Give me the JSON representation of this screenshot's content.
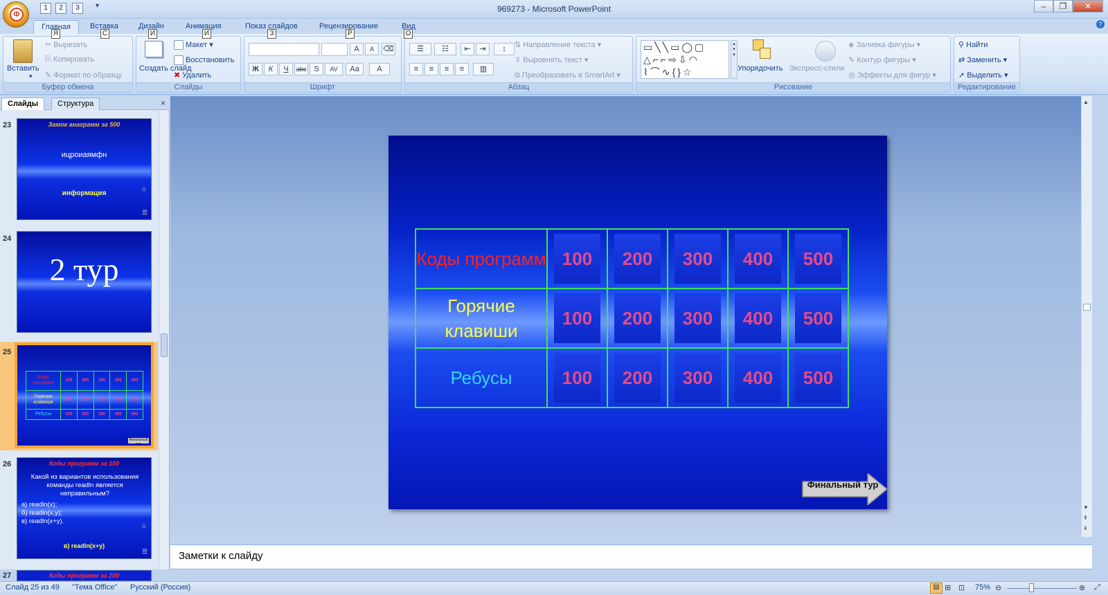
{
  "window": {
    "title": "969273 - Microsoft PowerPoint",
    "qat_keys": [
      "1",
      "2",
      "3"
    ],
    "office_key": "Ф"
  },
  "tabs": [
    {
      "label": "Главная",
      "key": "Я"
    },
    {
      "label": "Вставка",
      "key": "С"
    },
    {
      "label": "Дизайн",
      "key": "И"
    },
    {
      "label": "Анимация",
      "key": "И"
    },
    {
      "label": "Показ слайдов",
      "key": "З"
    },
    {
      "label": "Рецензирование",
      "key": "Р"
    },
    {
      "label": "Вид",
      "key": "О"
    }
  ],
  "ribbon": {
    "clipboard": {
      "label": "Буфер обмена",
      "paste": "Вставить",
      "cut": "Вырезать",
      "copy": "Копировать",
      "format": "Формат по образцу"
    },
    "slides": {
      "label": "Слайды",
      "create": "Создать слайд",
      "layout": "Макет",
      "reset": "Восстановить",
      "delete": "Удалить"
    },
    "font": {
      "label": "Шрифт"
    },
    "paragraph": {
      "label": "Абзац",
      "direction": "Направление текста",
      "align": "Выровнять текст",
      "smartart": "Преобразовать в SmartArt"
    },
    "drawing": {
      "label": "Рисование",
      "arrange": "Упорядочить",
      "styles": "Экспресс-стили",
      "fill": "Заливка фигуры",
      "outline": "Контур фигуры",
      "effects": "Эффекты для фигур"
    },
    "editing": {
      "label": "Редактирование",
      "find": "Найти",
      "replace": "Заменить",
      "select": "Выделить"
    }
  },
  "panel": {
    "tab_slides": "Слайды",
    "tab_outline": "Структура",
    "close": "×"
  },
  "thumbs": [
    {
      "num": "23",
      "title": "Замок анаграмм за 500",
      "body": "ицроиаямфн",
      "answer": "информация"
    },
    {
      "num": "24",
      "title": "2 тур"
    },
    {
      "num": "25"
    },
    {
      "num": "26",
      "title": "Коды программ за 100",
      "body": "Какой из вариантов использования команды readln является неправильным?",
      "opts": [
        "а) readln(x);",
        "б) readln(x,y);",
        "в) readln(x+y)."
      ],
      "answer": "в) readln(x+y)"
    },
    {
      "num": "27",
      "title": "Коды программ за 200"
    }
  ],
  "slide": {
    "rows": [
      {
        "category": "Коды программ",
        "color": "#ff2020",
        "values": [
          "100",
          "200",
          "300",
          "400",
          "500"
        ]
      },
      {
        "category": "Горячие клавиши",
        "color": "#ffff40",
        "values": [
          "100",
          "200",
          "300",
          "400",
          "500"
        ]
      },
      {
        "category": "Ребусы",
        "color": "#30d8f0",
        "values": [
          "100",
          "200",
          "300",
          "400",
          "500"
        ]
      }
    ],
    "final_button": "Финальный тур"
  },
  "notes": {
    "placeholder": "Заметки к слайду"
  },
  "status": {
    "slide": "Слайд 25 из 49",
    "theme": "\"Тема Office\"",
    "lang": "Русский (Россия)",
    "zoom": "75%"
  }
}
